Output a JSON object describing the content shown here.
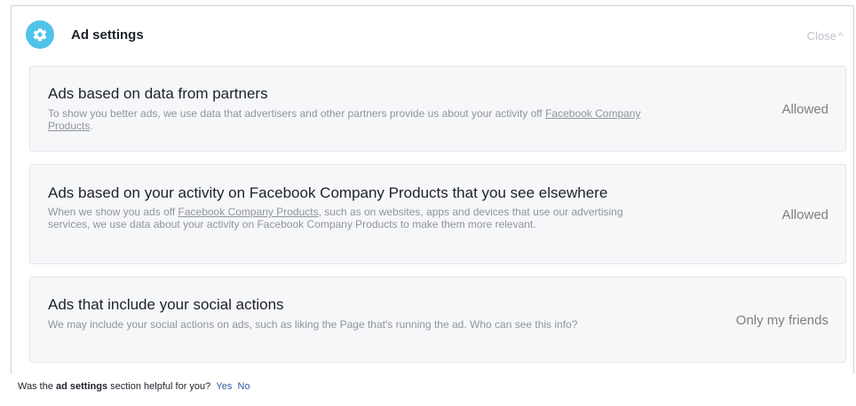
{
  "header": {
    "title": "Ad settings",
    "close_label": "Close",
    "icon": "gear-icon"
  },
  "cards": [
    {
      "title": "Ads based on data from partners",
      "desc_before": "To show you better ads, we use data that advertisers and other partners provide us about your activity off ",
      "link": "Facebook Company Products",
      "desc_after": ".",
      "value": "Allowed"
    },
    {
      "title": "Ads based on your activity on Facebook Company Products that you see elsewhere",
      "desc_before": "When we show you ads off ",
      "link": "Facebook Company Products",
      "desc_after": ", such as on websites, apps and devices that use our advertising services, we use data about your activity on Facebook Company Products to make them more relevant.",
      "value": "Allowed"
    },
    {
      "title": "Ads that include your social actions",
      "desc_before": "We may include your social actions on ads, such as liking the Page that's running the ad. Who can see this info?",
      "value": "Only my friends"
    }
  ],
  "feedback": {
    "text_before": "Was the ",
    "bold": "ad settings",
    "text_after": " section helpful for you?",
    "yes_label": "Yes",
    "no_label": "No"
  },
  "colors": {
    "accent_icon": "#4fc3e8",
    "link": "#365899",
    "card_bg": "#f6f7f9",
    "muted_text": "#90949c"
  }
}
